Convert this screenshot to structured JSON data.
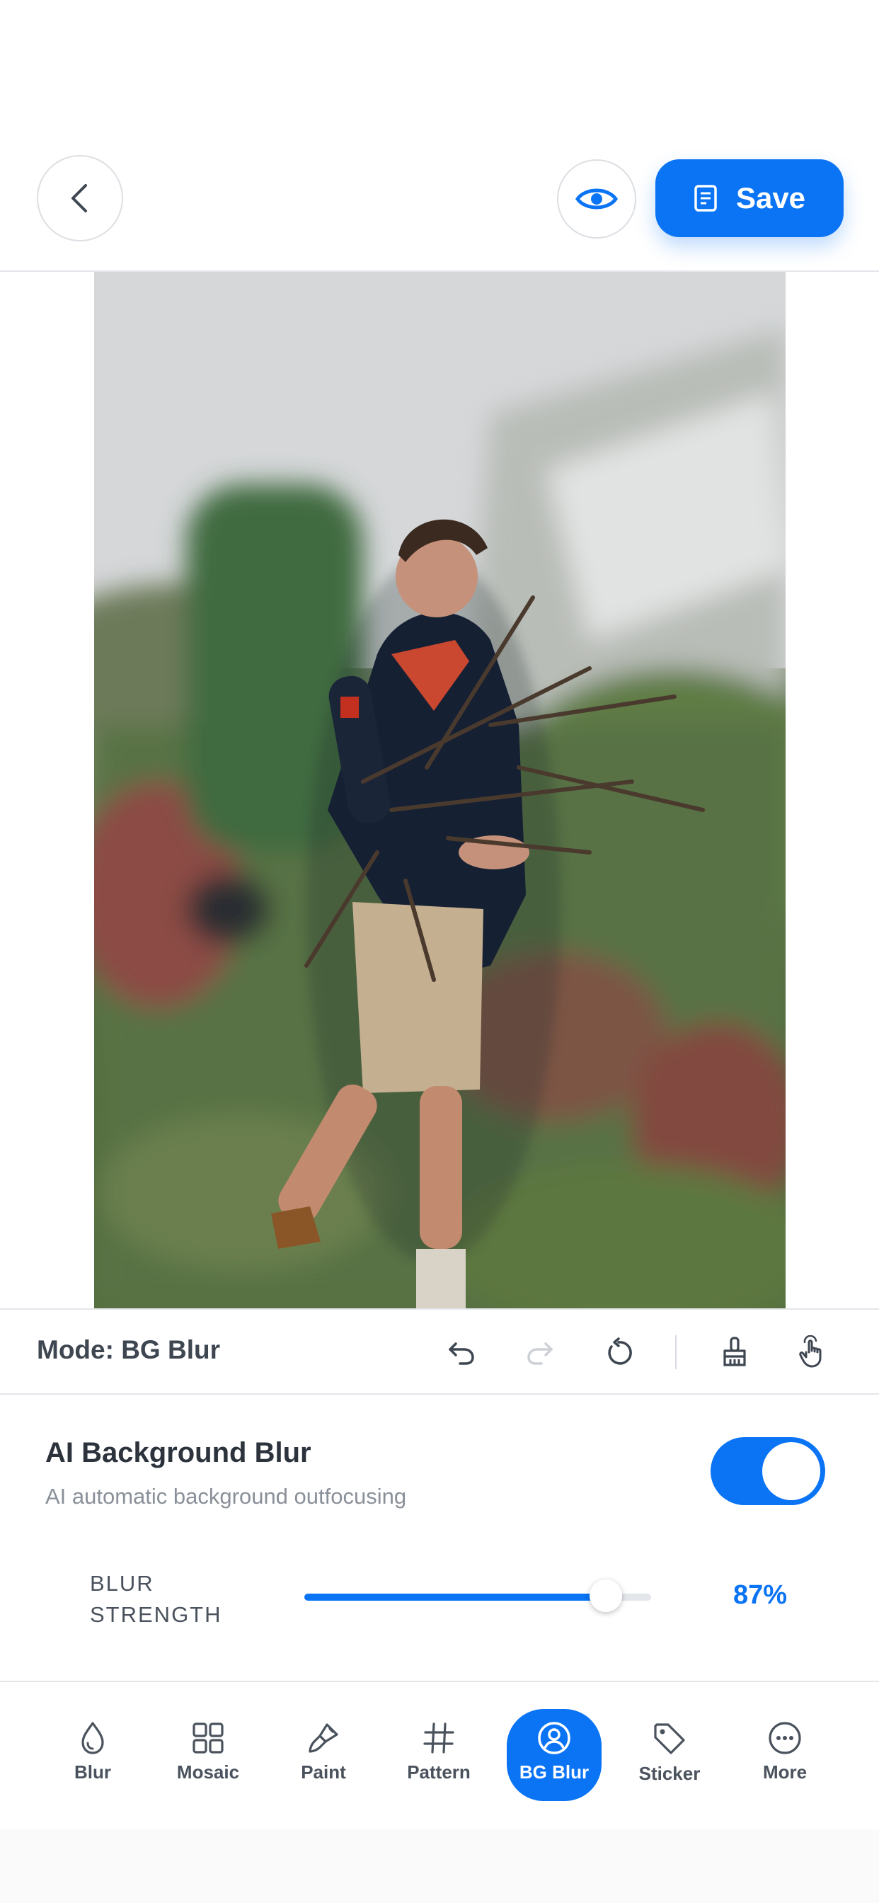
{
  "header": {
    "back_icon": "chevron-left-icon",
    "preview_icon": "eye-icon",
    "save_icon": "document-icon",
    "save_label": "Save",
    "accent_color": "#0a74f5"
  },
  "modebar": {
    "mode_label": "Mode: BG Blur",
    "tools": [
      {
        "name": "undo-icon",
        "enabled": true
      },
      {
        "name": "redo-icon",
        "enabled": false
      },
      {
        "name": "reset-icon",
        "enabled": true
      },
      {
        "name": "brush-icon",
        "enabled": true
      },
      {
        "name": "hand-pointer-icon",
        "enabled": true
      }
    ]
  },
  "settings": {
    "title": "AI Background Blur",
    "subtitle": "AI automatic background outfocusing",
    "toggle_on": true,
    "blur_label_line1": "BLUR",
    "blur_label_line2": "STRENGTH",
    "blur_value": 87,
    "blur_value_text": "87%"
  },
  "nav": {
    "items": [
      {
        "label": "Blur",
        "icon": "drop-icon",
        "active": false
      },
      {
        "label": "Mosaic",
        "icon": "grid-icon",
        "active": false
      },
      {
        "label": "Paint",
        "icon": "paintbrush-icon",
        "active": false
      },
      {
        "label": "Pattern",
        "icon": "hash-icon",
        "active": false
      },
      {
        "label": "BG Blur",
        "icon": "person-circle-icon",
        "active": true
      },
      {
        "label": "Sticker",
        "icon": "tag-icon",
        "active": false
      },
      {
        "label": "More",
        "icon": "more-icon",
        "active": false
      }
    ]
  }
}
